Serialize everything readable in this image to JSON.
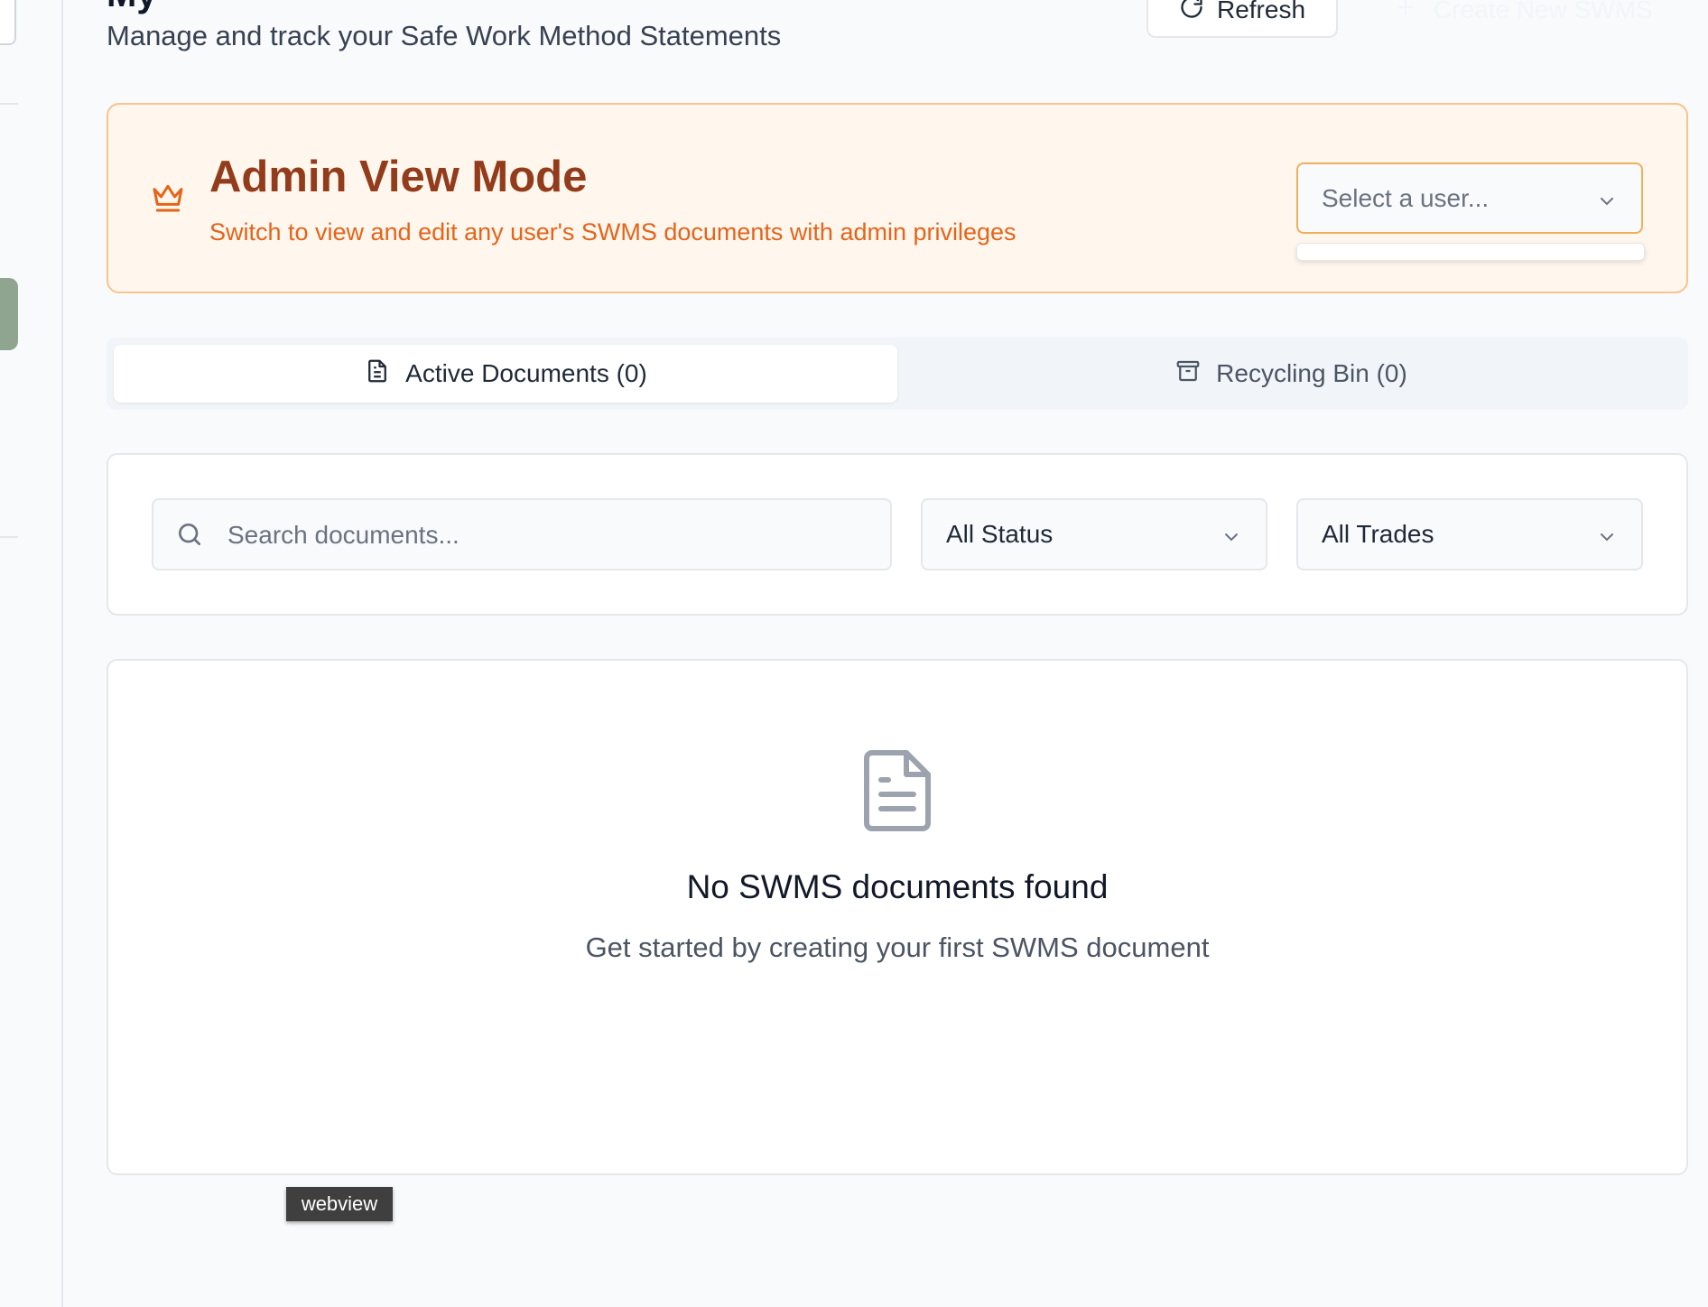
{
  "header": {
    "title_partial": "My",
    "subtitle": "Manage and track your Safe Work Method Statements",
    "refresh_label": "Refresh",
    "create_label": "Create New SWMS"
  },
  "admin": {
    "icon": "crown-icon",
    "title": "Admin View Mode",
    "description": "Switch to view and edit any user's SWMS documents with admin privileges",
    "user_select_placeholder": "Select a user..."
  },
  "tabs": [
    {
      "label": "Active Documents (0)",
      "icon": "document-icon",
      "active": true
    },
    {
      "label": "Recycling Bin (0)",
      "icon": "archive-icon",
      "active": false
    }
  ],
  "filters": {
    "search_placeholder": "Search documents...",
    "status_value": "All Status",
    "trade_value": "All Trades"
  },
  "empty_state": {
    "icon": "document-icon",
    "title": "No SWMS documents found",
    "description": "Get started by creating your first SWMS document"
  },
  "tooltip": "webview",
  "colors": {
    "admin_bg": "#fff6ed",
    "admin_border": "#f7c48e",
    "admin_title": "#933c1b",
    "admin_accent": "#e4641a",
    "sidebar_active": "#8fa58f"
  }
}
